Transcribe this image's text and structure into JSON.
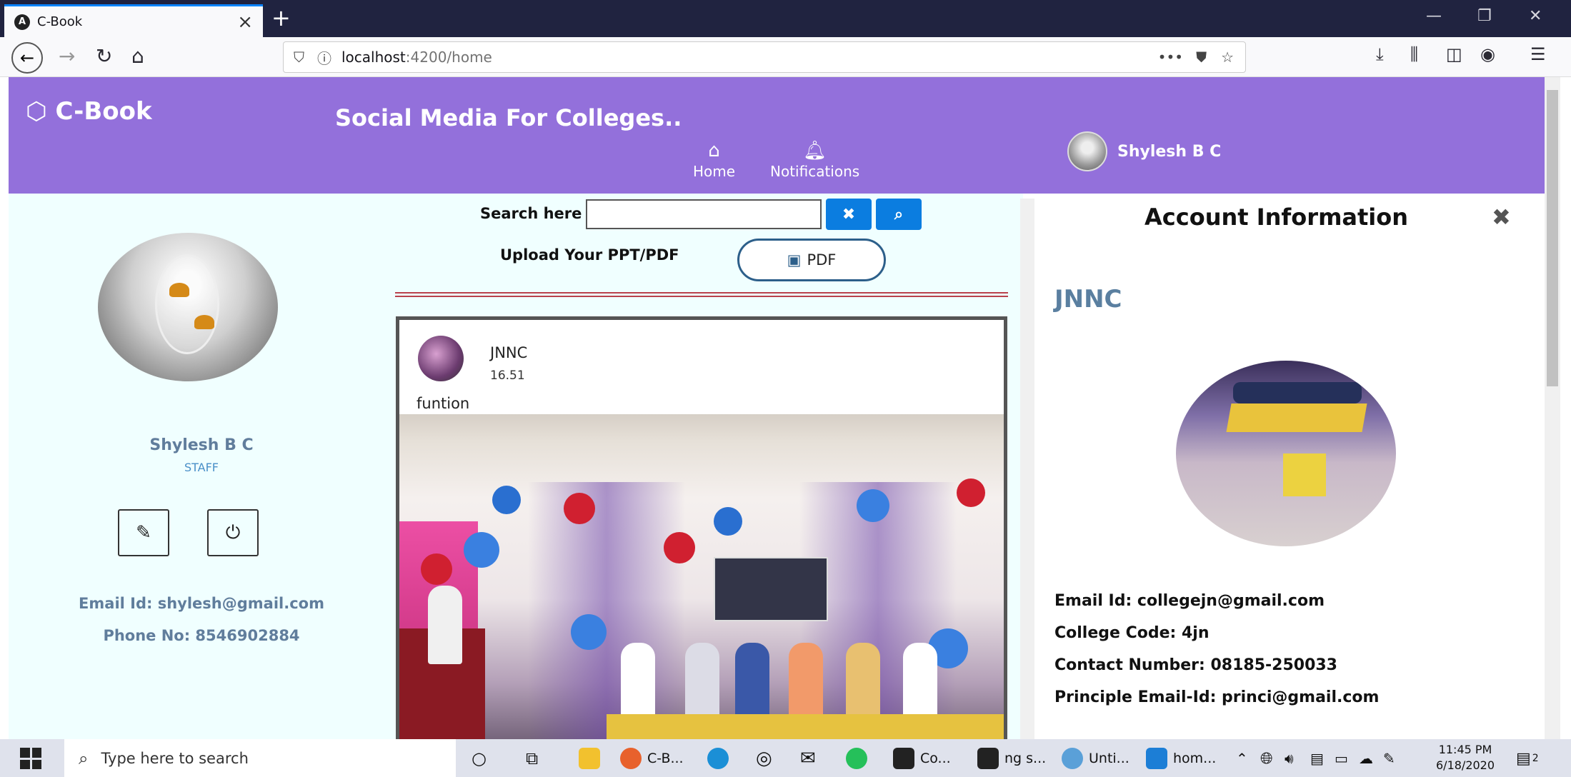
{
  "browser": {
    "tab_title": "C-Book",
    "url_host": "localhost",
    "url_path": ":4200/home",
    "more_label": "•••"
  },
  "header": {
    "brand": "C-Book",
    "tagline": "Social Media For Colleges..",
    "nav": [
      {
        "label": "Home",
        "icon": "home-icon"
      },
      {
        "label": "Notifications",
        "icon": "bell-icon"
      }
    ],
    "user_name": "Shylesh B C"
  },
  "profile": {
    "name": "Shylesh B C",
    "role": "STAFF",
    "email": "Email Id: shylesh@gmail.com",
    "phone": "Phone No: 8546902884"
  },
  "feed": {
    "search_label": "Search here",
    "search_value": "",
    "upload_label": "Upload Your PPT/PDF",
    "pdf_button": "PDF",
    "post": {
      "author": "JNNC",
      "time": "16.51",
      "text": "funtion"
    }
  },
  "account": {
    "title": "Account Information",
    "name": "JNNC",
    "email": "Email Id: collegejn@gmail.com",
    "college_code": "College Code: 4jn",
    "contact": "Contact Number: 08185-250033",
    "principal_email": "Principle Email-Id: princi@gmail.com"
  },
  "taskbar": {
    "search_placeholder": "Type here to search",
    "apps": [
      "C-B...",
      "Co...",
      "ng s...",
      "Unti...",
      "hom..."
    ],
    "time": "11:45 PM",
    "date": "6/18/2020",
    "notification_count": "2"
  },
  "colors": {
    "header": "#9370db",
    "panel": "#f0ffff",
    "accent_blue": "#0b7de0"
  }
}
